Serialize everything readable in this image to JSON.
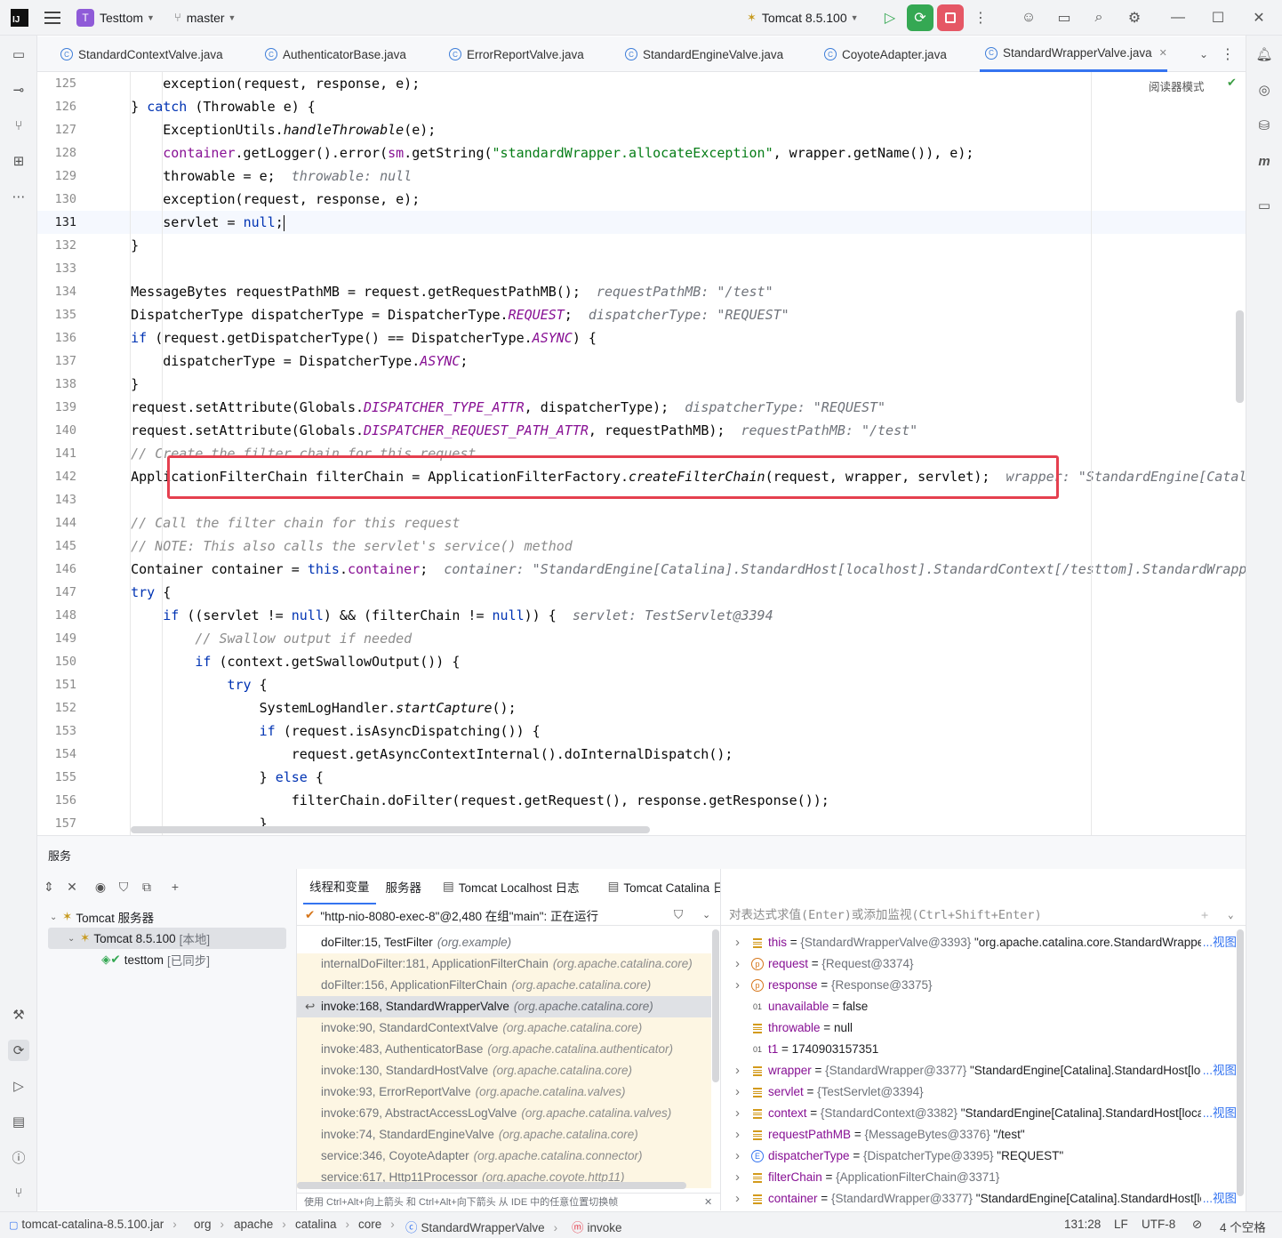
{
  "titlebar": {
    "logo": "IJ",
    "project_badge": "T",
    "project": "Testtom",
    "branch": "master",
    "run_config": "Tomcat 8.5.100"
  },
  "tabs": [
    {
      "label": "StandardContextValve.java"
    },
    {
      "label": "AuthenticatorBase.java"
    },
    {
      "label": "ErrorReportValve.java"
    },
    {
      "label": "StandardEngineValve.java"
    },
    {
      "label": "CoyoteAdapter.java"
    },
    {
      "label": "StandardWrapperValve.java",
      "active": true
    }
  ],
  "editor": {
    "reader_mode": "阅读器模式",
    "lines": [
      {
        "n": "125",
        "parts": [
          [
            "        exception(request, response, e);",
            ""
          ]
        ]
      },
      {
        "n": "126",
        "parts": [
          [
            "    } ",
            ""
          ],
          [
            "catch",
            "kw"
          ],
          [
            " (Throwable e) {",
            ""
          ]
        ]
      },
      {
        "n": "127",
        "parts": [
          [
            "        ExceptionUtils.",
            ""
          ],
          [
            "handleThrowable",
            "mi"
          ],
          [
            "(e);",
            ""
          ]
        ]
      },
      {
        "n": "128",
        "parts": [
          [
            "        ",
            ""
          ],
          [
            "container",
            "fld"
          ],
          [
            ".getLogger().error(",
            ""
          ],
          [
            "sm",
            "fld"
          ],
          [
            ".getString(",
            ""
          ],
          [
            "\"standardWrapper.allocateException\"",
            "str"
          ],
          [
            ", wrapper.getName()), e);",
            ""
          ]
        ]
      },
      {
        "n": "129",
        "parts": [
          [
            "        throwable = e;  ",
            ""
          ],
          [
            "throwable: null",
            "hint"
          ]
        ]
      },
      {
        "n": "130",
        "parts": [
          [
            "        exception(request, response, e);",
            ""
          ]
        ]
      },
      {
        "n": "131",
        "current": true,
        "parts": [
          [
            "        servlet = ",
            ""
          ],
          [
            "null",
            "kw"
          ],
          [
            ";",
            ""
          ]
        ]
      },
      {
        "n": "132",
        "parts": [
          [
            "    }",
            ""
          ]
        ]
      },
      {
        "n": "133",
        "parts": []
      },
      {
        "n": "134",
        "parts": [
          [
            "    MessageBytes requestPathMB = request.getRequestPathMB();  ",
            ""
          ],
          [
            "requestPathMB: \"/test\"",
            "hint"
          ]
        ]
      },
      {
        "n": "135",
        "parts": [
          [
            "    DispatcherType dispatcherType = DispatcherType.",
            ""
          ],
          [
            "REQUEST",
            "fldi"
          ],
          [
            ";  ",
            ""
          ],
          [
            "dispatcherType: \"REQUEST\"",
            "hint"
          ]
        ]
      },
      {
        "n": "136",
        "parts": [
          [
            "    ",
            ""
          ],
          [
            "if",
            "kw"
          ],
          [
            " (request.getDispatcherType() == DispatcherType.",
            ""
          ],
          [
            "ASYNC",
            "fldi"
          ],
          [
            ") {",
            ""
          ]
        ]
      },
      {
        "n": "137",
        "parts": [
          [
            "        dispatcherType = DispatcherType.",
            ""
          ],
          [
            "ASYNC",
            "fldi"
          ],
          [
            ";",
            ""
          ]
        ]
      },
      {
        "n": "138",
        "parts": [
          [
            "    }",
            ""
          ]
        ]
      },
      {
        "n": "139",
        "parts": [
          [
            "    request.setAttribute(Globals.",
            ""
          ],
          [
            "DISPATCHER_TYPE_ATTR",
            "fldi"
          ],
          [
            ", dispatcherType);  ",
            ""
          ],
          [
            "dispatcherType: \"REQUEST\"",
            "hint"
          ]
        ]
      },
      {
        "n": "140",
        "parts": [
          [
            "    request.setAttribute(Globals.",
            ""
          ],
          [
            "DISPATCHER_REQUEST_PATH_ATTR",
            "fldi"
          ],
          [
            ", requestPathMB);  ",
            ""
          ],
          [
            "requestPathMB: \"/test\"",
            "hint"
          ]
        ]
      },
      {
        "n": "141",
        "parts": [
          [
            "    ",
            ""
          ],
          [
            "// Create the filter chain for this request",
            "cmt"
          ]
        ]
      },
      {
        "n": "142",
        "parts": [
          [
            "    ApplicationFilterChain filterChain = ApplicationFilterFactory.",
            ""
          ],
          [
            "createFilterChain",
            "mi"
          ],
          [
            "(request, wrapper, servlet);  ",
            ""
          ],
          [
            "wrapper: \"StandardEngine[Catalina].StandardHost[localhost].StandardContext[/testtom]",
            "hint"
          ]
        ]
      },
      {
        "n": "143",
        "parts": []
      },
      {
        "n": "144",
        "parts": [
          [
            "    ",
            ""
          ],
          [
            "// Call the filter chain for this request",
            "cmt"
          ]
        ]
      },
      {
        "n": "145",
        "parts": [
          [
            "    ",
            ""
          ],
          [
            "// NOTE: This also calls the servlet's service() method",
            "cmt"
          ]
        ]
      },
      {
        "n": "146",
        "parts": [
          [
            "    Container container = ",
            ""
          ],
          [
            "this",
            "kw"
          ],
          [
            ".",
            ""
          ],
          [
            "container",
            "fld"
          ],
          [
            ";  ",
            ""
          ],
          [
            "container: \"StandardEngine[Catalina].StandardHost[localhost].StandardContext[/testtom].StandardWrapper",
            "hint"
          ]
        ]
      },
      {
        "n": "147",
        "parts": [
          [
            "    ",
            ""
          ],
          [
            "try",
            "kw"
          ],
          [
            " {",
            ""
          ]
        ]
      },
      {
        "n": "148",
        "parts": [
          [
            "        ",
            ""
          ],
          [
            "if",
            "kw"
          ],
          [
            " ((servlet != ",
            ""
          ],
          [
            "null",
            "kw"
          ],
          [
            ") && (filterChain != ",
            ""
          ],
          [
            "null",
            "kw"
          ],
          [
            ")) {  ",
            ""
          ],
          [
            "servlet: TestServlet@3394",
            "hint"
          ]
        ]
      },
      {
        "n": "149",
        "parts": [
          [
            "            ",
            ""
          ],
          [
            "// Swallow output if needed",
            "cmt"
          ]
        ]
      },
      {
        "n": "150",
        "parts": [
          [
            "            ",
            ""
          ],
          [
            "if",
            "kw"
          ],
          [
            " (context.getSwallowOutput()) {",
            ""
          ]
        ]
      },
      {
        "n": "151",
        "parts": [
          [
            "                ",
            ""
          ],
          [
            "try",
            "kw"
          ],
          [
            " {",
            ""
          ]
        ]
      },
      {
        "n": "152",
        "parts": [
          [
            "                    SystemLogHandler.",
            ""
          ],
          [
            "startCapture",
            "mi"
          ],
          [
            "();",
            ""
          ]
        ]
      },
      {
        "n": "153",
        "parts": [
          [
            "                    ",
            ""
          ],
          [
            "if",
            "kw"
          ],
          [
            " (request.isAsyncDispatching()) {",
            ""
          ]
        ]
      },
      {
        "n": "154",
        "parts": [
          [
            "                        request.getAsyncContextInternal().doInternalDispatch();",
            ""
          ]
        ]
      },
      {
        "n": "155",
        "parts": [
          [
            "                    } ",
            ""
          ],
          [
            "else",
            "kw"
          ],
          [
            " {",
            ""
          ]
        ]
      },
      {
        "n": "156",
        "parts": [
          [
            "                        filterChain.doFilter(request.getRequest(), response.getResponse());",
            ""
          ]
        ]
      },
      {
        "n": "157",
        "parts": [
          [
            "                    }",
            ""
          ]
        ]
      }
    ]
  },
  "services": {
    "title": "服务",
    "tree": {
      "root": "Tomcat 服务器",
      "server": "Tomcat 8.5.100",
      "server_tag": "[本地]",
      "app": "testtom",
      "app_tag": "[已同步]"
    },
    "debug_tabs": [
      "线程和变量",
      "服务器",
      "Tomcat Localhost 日志",
      "Tomcat Catalina 日志"
    ],
    "thread": "\"http-nio-8080-exec-8\"@2,480 在组\"main\": 正在运行",
    "frames": [
      {
        "method": "doFilter:15, TestFilter",
        "pkg": "(org.example)",
        "kind": "user"
      },
      {
        "method": "internalDoFilter:181, ApplicationFilterChain",
        "pkg": "(org.apache.catalina.core)",
        "kind": "lib"
      },
      {
        "method": "doFilter:156, ApplicationFilterChain",
        "pkg": "(org.apache.catalina.core)",
        "kind": "lib"
      },
      {
        "method": "invoke:168, StandardWrapperValve",
        "pkg": "(org.apache.catalina.core)",
        "kind": "cur"
      },
      {
        "method": "invoke:90, StandardContextValve",
        "pkg": "(org.apache.catalina.core)",
        "kind": "lib"
      },
      {
        "method": "invoke:483, AuthenticatorBase",
        "pkg": "(org.apache.catalina.authenticator)",
        "kind": "lib"
      },
      {
        "method": "invoke:130, StandardHostValve",
        "pkg": "(org.apache.catalina.core)",
        "kind": "lib"
      },
      {
        "method": "invoke:93, ErrorReportValve",
        "pkg": "(org.apache.catalina.valves)",
        "kind": "lib"
      },
      {
        "method": "invoke:679, AbstractAccessLogValve",
        "pkg": "(org.apache.catalina.valves)",
        "kind": "lib"
      },
      {
        "method": "invoke:74, StandardEngineValve",
        "pkg": "(org.apache.catalina.core)",
        "kind": "lib"
      },
      {
        "method": "service:346, CoyoteAdapter",
        "pkg": "(org.apache.catalina.connector)",
        "kind": "lib"
      },
      {
        "method": "service:617, Http11Processor",
        "pkg": "(org.apache.coyote.http11)",
        "kind": "lib"
      }
    ],
    "frames_hint": "使用 Ctrl+Alt+向上箭头 和 Ctrl+Alt+向下箭头 从 IDE 中的任意位置切换帧",
    "eval_placeholder": "对表达式求值(Enter)或添加监视(Ctrl+Shift+Enter)",
    "variables": [
      {
        "name": "this",
        "type": "{StandardWrapperValve@3393}",
        "value": "\"org.apache.catalina.core.StandardWrapperValve[testServlet]\"",
        "icon": "f",
        "expand": true,
        "link": "...视图"
      },
      {
        "name": "request",
        "type": "{Request@3374}",
        "value": "",
        "icon": "p",
        "expand": true,
        "link": ""
      },
      {
        "name": "response",
        "type": "{Response@3375}",
        "value": "",
        "icon": "p",
        "expand": true,
        "link": ""
      },
      {
        "name": "unavailable",
        "type": "",
        "value": "false",
        "icon": "b",
        "expand": false,
        "link": ""
      },
      {
        "name": "throwable",
        "type": "",
        "value": "null",
        "icon": "f",
        "expand": false,
        "link": ""
      },
      {
        "name": "t1",
        "type": "",
        "value": "1740903157351",
        "icon": "b",
        "expand": false,
        "link": ""
      },
      {
        "name": "wrapper",
        "type": "{StandardWrapper@3377}",
        "value": "\"StandardEngine[Catalina].StandardHost[localhost]\"",
        "icon": "f",
        "expand": true,
        "link": "...视图"
      },
      {
        "name": "servlet",
        "type": "{TestServlet@3394}",
        "value": "",
        "icon": "f",
        "expand": true,
        "link": ""
      },
      {
        "name": "context",
        "type": "{StandardContext@3382}",
        "value": "\"StandardEngine[Catalina].StandardHost[localhost]\"",
        "icon": "f",
        "expand": true,
        "link": "...视图"
      },
      {
        "name": "requestPathMB",
        "type": "{MessageBytes@3376}",
        "value": "\"/test\"",
        "icon": "f",
        "expand": true,
        "link": ""
      },
      {
        "name": "dispatcherType",
        "type": "{DispatcherType@3395}",
        "value": "\"REQUEST\"",
        "icon": "e",
        "expand": true,
        "link": ""
      },
      {
        "name": "filterChain",
        "type": "{ApplicationFilterChain@3371}",
        "value": "",
        "icon": "f",
        "expand": true,
        "link": ""
      },
      {
        "name": "container",
        "type": "{StandardWrapper@3377}",
        "value": "\"StandardEngine[Catalina].StandardHost[localhost]\"",
        "icon": "f",
        "expand": true,
        "link": "...视图"
      }
    ]
  },
  "statusbar": {
    "breadcrumbs": [
      "tomcat-catalina-8.5.100.jar",
      "org",
      "apache",
      "catalina",
      "core",
      "StandardWrapperValve",
      "invoke"
    ],
    "position": "131:28",
    "line_sep": "LF",
    "encoding": "UTF-8",
    "indent": "4 个空格"
  }
}
